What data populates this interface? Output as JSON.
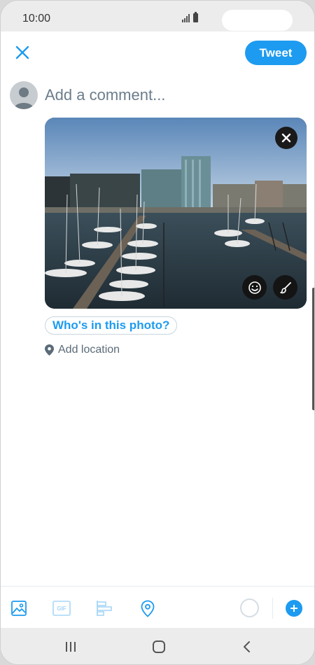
{
  "status_bar": {
    "time": "10:00"
  },
  "header": {
    "tweet_label": "Tweet"
  },
  "composer": {
    "placeholder": "Add a comment..."
  },
  "photo": {
    "tag_label": "Who's in this photo?"
  },
  "location": {
    "label": "Add location"
  },
  "toolbar": {
    "gif_label": "GIF"
  },
  "colors": {
    "accent": "#1d9bf0",
    "muted_text": "#5b6b78"
  }
}
